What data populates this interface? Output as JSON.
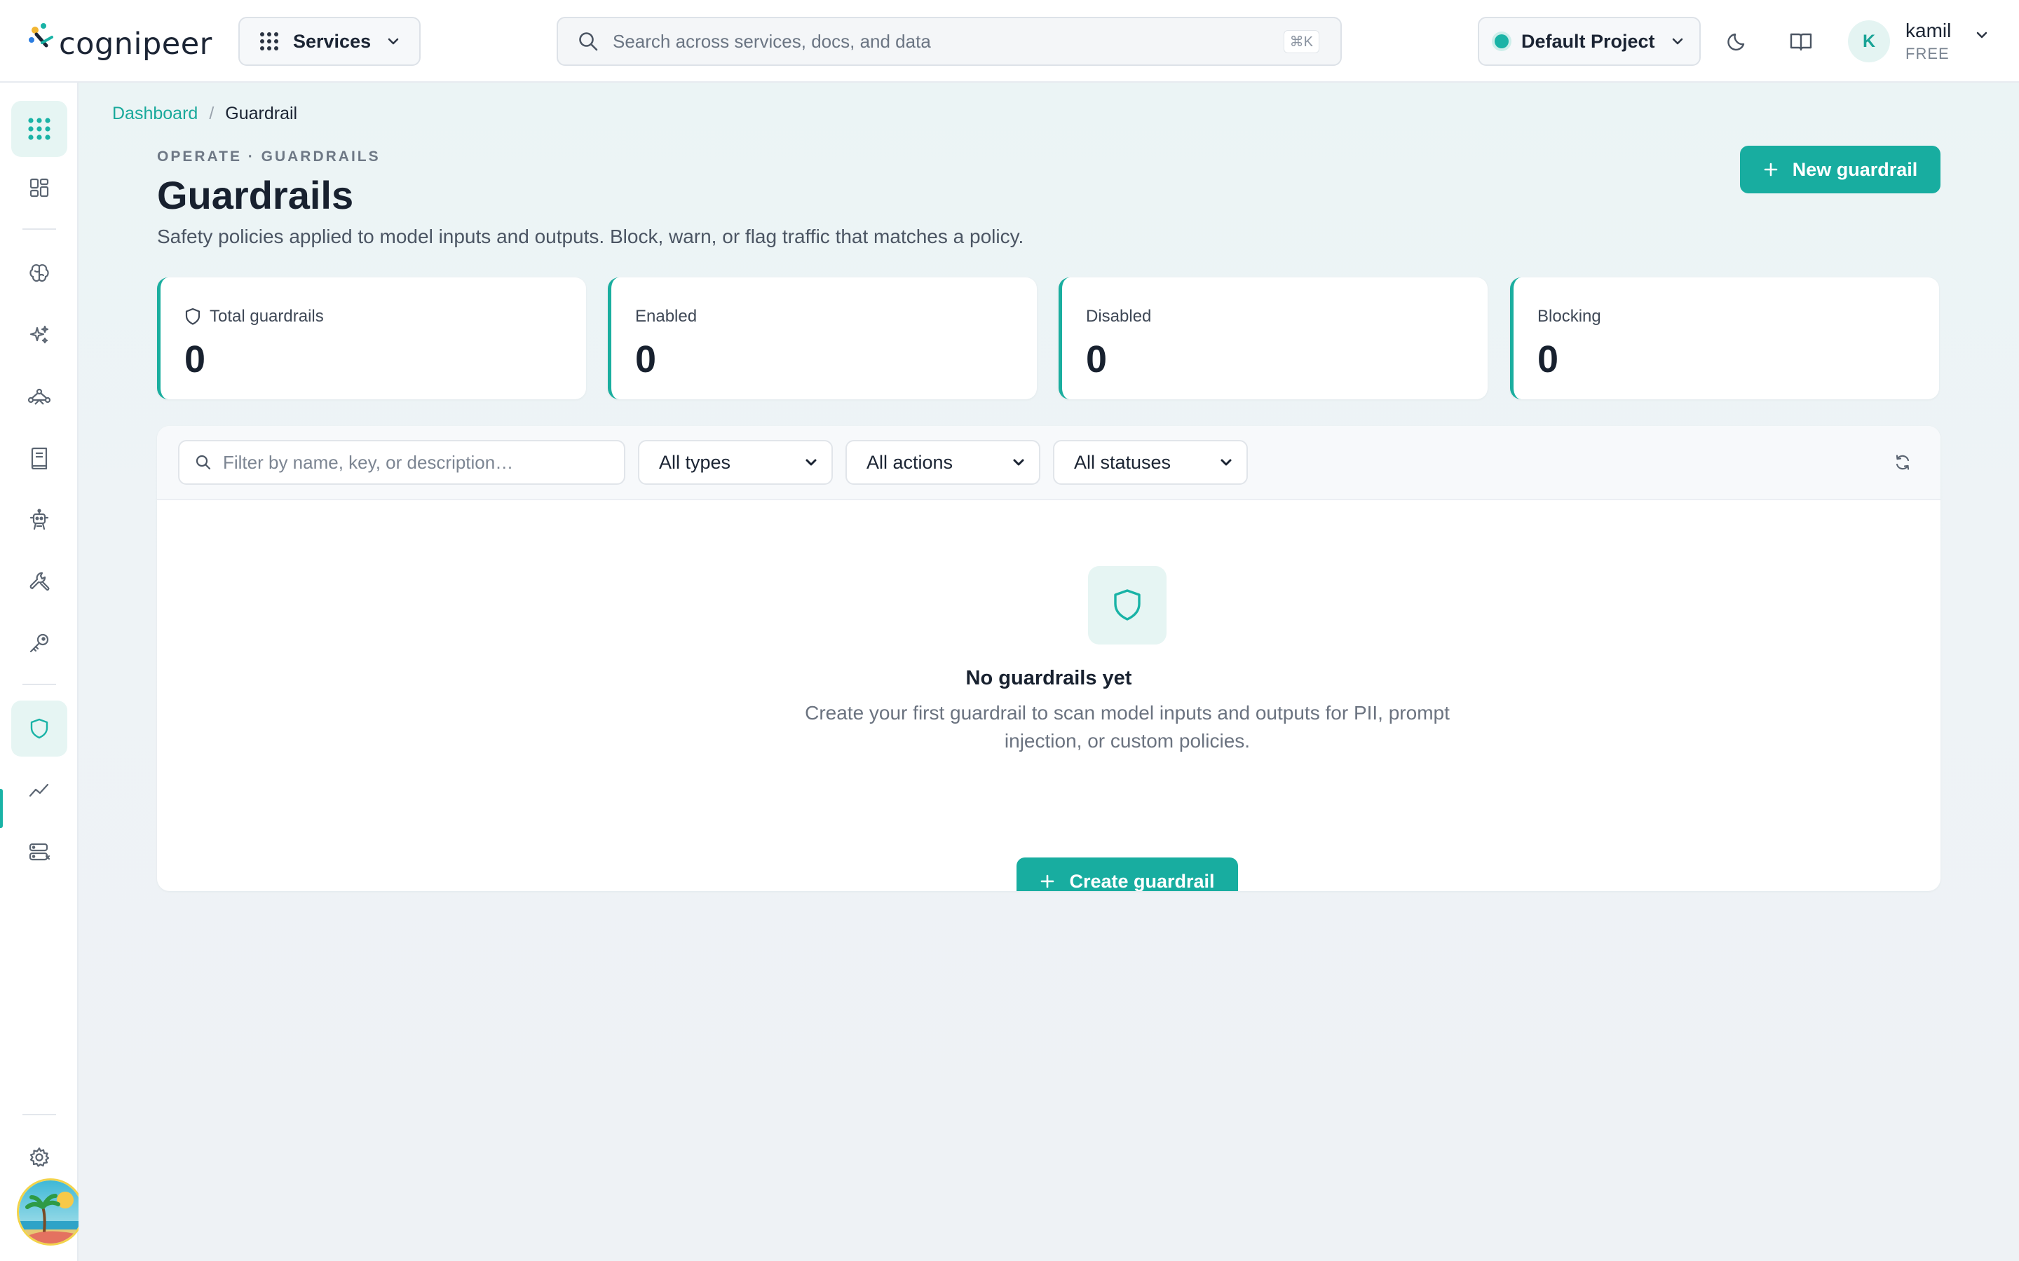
{
  "header": {
    "brand": "cognipeer",
    "services_label": "Services",
    "search_placeholder": "Search across services, docs, and data",
    "search_shortcut": "⌘K",
    "project_label": "Default Project",
    "user_initial": "K",
    "user_name": "kamil",
    "user_plan": "FREE"
  },
  "sidebar": {
    "items": [
      {
        "icon": "apps-grid-icon",
        "active": true
      },
      {
        "icon": "dashboard-icon"
      },
      {
        "icon": "brain-icon"
      },
      {
        "icon": "sparkles-icon"
      },
      {
        "icon": "flow-icon"
      },
      {
        "icon": "book-icon"
      },
      {
        "icon": "robot-icon"
      },
      {
        "icon": "tools-icon"
      },
      {
        "icon": "key-icon"
      },
      {
        "icon": "shield-icon",
        "active": true
      },
      {
        "icon": "trend-icon"
      },
      {
        "icon": "database-icon"
      },
      {
        "icon": "gear-icon"
      }
    ]
  },
  "breadcrumb": {
    "root": "Dashboard",
    "separator": "/",
    "current": "Guardrail"
  },
  "page": {
    "eyebrow": "OPERATE · GUARDRAILS",
    "title": "Guardrails",
    "subtitle": "Safety policies applied to model inputs and outputs. Block, warn, or flag traffic that matches a policy.",
    "new_button": "New guardrail"
  },
  "stats": [
    {
      "label": "Total guardrails",
      "value": "0"
    },
    {
      "label": "Enabled",
      "value": "0"
    },
    {
      "label": "Disabled",
      "value": "0"
    },
    {
      "label": "Blocking",
      "value": "0"
    }
  ],
  "filters": {
    "search_placeholder": "Filter by name, key, or description…",
    "type": "All types",
    "action": "All actions",
    "status": "All statuses"
  },
  "empty_state": {
    "title": "No guardrails yet",
    "description": "Create your first guardrail to scan model inputs and outputs for PII, prompt injection, or custom policies.",
    "button": "Create guardrail"
  },
  "colors": {
    "accent": "#18ada0",
    "accent_soft": "#e6f5f3",
    "link": "#18a99b"
  }
}
